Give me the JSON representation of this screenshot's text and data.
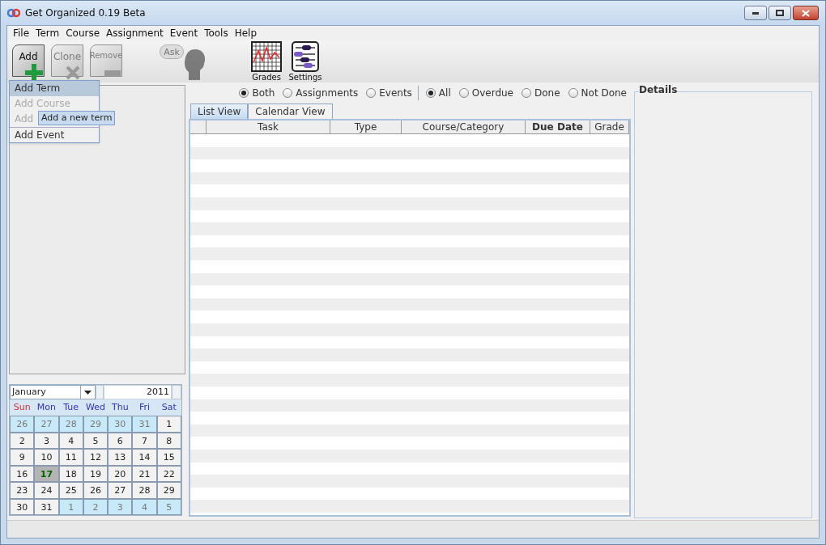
{
  "window": {
    "title": "Get Organized 0.19 Beta"
  },
  "menu": [
    "File",
    "Term",
    "Course",
    "Assignment",
    "Event",
    "Tools",
    "Help"
  ],
  "toolbar": [
    {
      "kind": "add",
      "icon_text": "Add",
      "disabled": false
    },
    {
      "kind": "clone",
      "icon_text": "Clone",
      "disabled": true
    },
    {
      "kind": "remove",
      "icon_text": "Remove",
      "disabled": true
    },
    {
      "kind": "ask",
      "icon_text": "Ask",
      "disabled": true
    },
    {
      "kind": "grades",
      "caption": "Grades",
      "disabled": false
    },
    {
      "kind": "settings",
      "caption": "Settings",
      "disabled": false
    }
  ],
  "add_menu": [
    {
      "label": "Add Term",
      "selected": true,
      "disabled": false
    },
    {
      "label": "Add Course",
      "selected": false,
      "disabled": true
    },
    {
      "label": "Add",
      "selected": false,
      "disabled": true
    },
    {
      "label": "Add Event",
      "selected": false,
      "disabled": false
    }
  ],
  "tooltip": "Add a new term",
  "filters": [
    [
      {
        "label": "Both",
        "selected": true
      },
      {
        "label": "Assignments",
        "selected": false
      },
      {
        "label": "Events",
        "selected": false
      }
    ],
    [
      {
        "label": "All",
        "selected": true
      },
      {
        "label": "Overdue",
        "selected": false
      },
      {
        "label": "Done",
        "selected": false
      },
      {
        "label": "Not Done",
        "selected": false
      }
    ]
  ],
  "tabs": [
    {
      "label": "List View",
      "selected": true
    },
    {
      "label": "Calendar View",
      "selected": false
    }
  ],
  "table": {
    "columns": [
      {
        "label": "Task",
        "sorted": false
      },
      {
        "label": "Type",
        "sorted": false
      },
      {
        "label": "Course/Category",
        "sorted": false
      },
      {
        "label": "Due Date",
        "sorted": true
      },
      {
        "label": "Grade",
        "sorted": false
      }
    ]
  },
  "details": {
    "title": "Details"
  },
  "calendar": {
    "month": "January",
    "year": "2011",
    "weekdays": [
      {
        "label": "Sun",
        "color": "#cc3333"
      },
      {
        "label": "Mon",
        "color": "#3333bb"
      },
      {
        "label": "Tue",
        "color": "#3333bb"
      },
      {
        "label": "Wed",
        "color": "#3333bb"
      },
      {
        "label": "Thu",
        "color": "#3333bb"
      },
      {
        "label": "Fri",
        "color": "#3333bb"
      },
      {
        "label": "Sat",
        "color": "#3333bb"
      }
    ],
    "days": [
      {
        "label": "26",
        "other_month": true,
        "selected": false
      },
      {
        "label": "27",
        "other_month": true,
        "selected": false
      },
      {
        "label": "28",
        "other_month": true,
        "selected": false
      },
      {
        "label": "29",
        "other_month": true,
        "selected": false
      },
      {
        "label": "30",
        "other_month": true,
        "selected": false
      },
      {
        "label": "31",
        "other_month": true,
        "selected": false
      },
      {
        "label": "1",
        "other_month": false,
        "selected": false
      },
      {
        "label": "2",
        "other_month": false,
        "selected": false
      },
      {
        "label": "3",
        "other_month": false,
        "selected": false
      },
      {
        "label": "4",
        "other_month": false,
        "selected": false
      },
      {
        "label": "5",
        "other_month": false,
        "selected": false
      },
      {
        "label": "6",
        "other_month": false,
        "selected": false
      },
      {
        "label": "7",
        "other_month": false,
        "selected": false
      },
      {
        "label": "8",
        "other_month": false,
        "selected": false
      },
      {
        "label": "9",
        "other_month": false,
        "selected": false
      },
      {
        "label": "10",
        "other_month": false,
        "selected": false
      },
      {
        "label": "11",
        "other_month": false,
        "selected": false
      },
      {
        "label": "12",
        "other_month": false,
        "selected": false
      },
      {
        "label": "13",
        "other_month": false,
        "selected": false
      },
      {
        "label": "14",
        "other_month": false,
        "selected": false
      },
      {
        "label": "15",
        "other_month": false,
        "selected": false
      },
      {
        "label": "16",
        "other_month": false,
        "selected": false
      },
      {
        "label": "17",
        "other_month": false,
        "selected": true
      },
      {
        "label": "18",
        "other_month": false,
        "selected": false
      },
      {
        "label": "19",
        "other_month": false,
        "selected": false
      },
      {
        "label": "20",
        "other_month": false,
        "selected": false
      },
      {
        "label": "21",
        "other_month": false,
        "selected": false
      },
      {
        "label": "22",
        "other_month": false,
        "selected": false
      },
      {
        "label": "23",
        "other_month": false,
        "selected": false
      },
      {
        "label": "24",
        "other_month": false,
        "selected": false
      },
      {
        "label": "25",
        "other_month": false,
        "selected": false
      },
      {
        "label": "26",
        "other_month": false,
        "selected": false
      },
      {
        "label": "27",
        "other_month": false,
        "selected": false
      },
      {
        "label": "28",
        "other_month": false,
        "selected": false
      },
      {
        "label": "29",
        "other_month": false,
        "selected": false
      },
      {
        "label": "30",
        "other_month": false,
        "selected": false
      },
      {
        "label": "31",
        "other_month": false,
        "selected": false
      },
      {
        "label": "1",
        "other_month": true,
        "selected": false
      },
      {
        "label": "2",
        "other_month": true,
        "selected": false
      },
      {
        "label": "3",
        "other_month": true,
        "selected": false
      },
      {
        "label": "4",
        "other_month": true,
        "selected": false
      },
      {
        "label": "5",
        "other_month": true,
        "selected": false
      }
    ]
  }
}
